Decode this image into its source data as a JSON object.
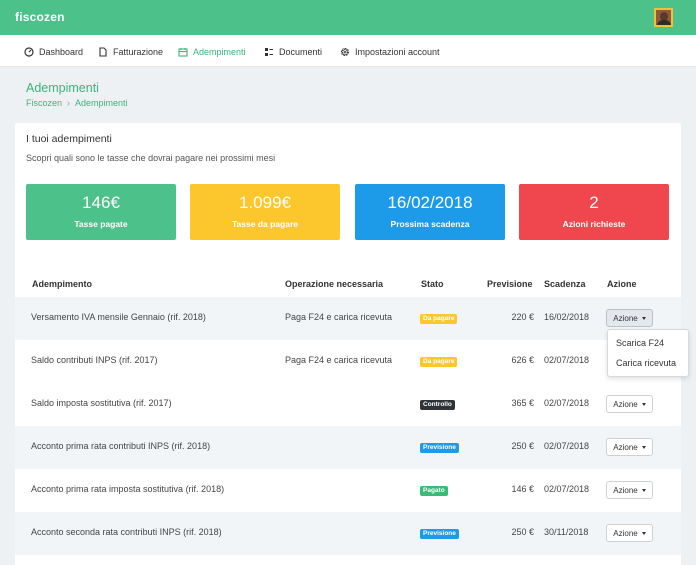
{
  "app": {
    "brand": "fiscozen"
  },
  "nav": [
    {
      "label": "Dashboard",
      "icon": "dashboard-icon"
    },
    {
      "label": "Fatturazione",
      "icon": "document-icon"
    },
    {
      "label": "Adempimenti",
      "icon": "calendar-icon",
      "active": true
    },
    {
      "label": "Documenti",
      "icon": "documents-icon"
    },
    {
      "label": "Impostazioni account",
      "icon": "gear-icon"
    }
  ],
  "page": {
    "title": "Adempimenti",
    "breadcrumb": [
      "Fiscozen",
      "Adempimenti"
    ]
  },
  "card": {
    "title": "I tuoi adempimenti",
    "subtitle": "Scopri quali sono le tasse che dovrai pagare nei prossimi mesi"
  },
  "stats": [
    {
      "value": "146€",
      "label": "Tasse pagate",
      "color": "#4dc18a"
    },
    {
      "value": "1.099€",
      "label": "Tasse da pagare",
      "color": "#fcc62d"
    },
    {
      "value": "16/02/2018",
      "label": "Prossima scadenza",
      "color": "#1e9be8"
    },
    {
      "value": "2",
      "label": "Azioni richieste",
      "color": "#f0464d"
    }
  ],
  "table": {
    "headers": [
      "Adempimento",
      "Operazione necessaria",
      "Stato",
      "Previsione",
      "Scadenza",
      "Azione"
    ],
    "rows": [
      {
        "name": "Versamento IVA mensile Gennaio (rif. 2018)",
        "operation": "Paga F24 e carica ricevuta",
        "status": "Da pagare",
        "status_color": "#fcc62d",
        "forecast": "220 €",
        "due": "16/02/2018",
        "action": "Azione"
      },
      {
        "name": "Saldo contributi INPS (rif. 2017)",
        "operation": "Paga F24 e carica ricevuta",
        "status": "Da pagare",
        "status_color": "#fcc62d",
        "forecast": "626 €",
        "due": "02/07/2018",
        "action": "Azione"
      },
      {
        "name": "Saldo imposta sostitutiva (rif. 2017)",
        "operation": "",
        "status": "Controllo",
        "status_color": "#2f3338",
        "forecast": "365 €",
        "due": "02/07/2018",
        "action": "Azione"
      },
      {
        "name": "Acconto prima rata contributi INPS (rif. 2018)",
        "operation": "",
        "status": "Previsione",
        "status_color": "#1e9be8",
        "forecast": "250 €",
        "due": "02/07/2018",
        "action": "Azione"
      },
      {
        "name": "Acconto prima rata imposta sostitutiva (rif. 2018)",
        "operation": "",
        "status": "Pagato",
        "status_color": "#3dbb76",
        "forecast": "146 €",
        "due": "02/07/2018",
        "action": "Azione"
      },
      {
        "name": "Acconto seconda rata contributi INPS (rif. 2018)",
        "operation": "",
        "status": "Previsione",
        "status_color": "#1e9be8",
        "forecast": "250 €",
        "due": "30/11/2018",
        "action": "Azione"
      }
    ]
  },
  "dropdown": {
    "items": [
      "Scarica F24",
      "Carica ricevuta"
    ]
  }
}
